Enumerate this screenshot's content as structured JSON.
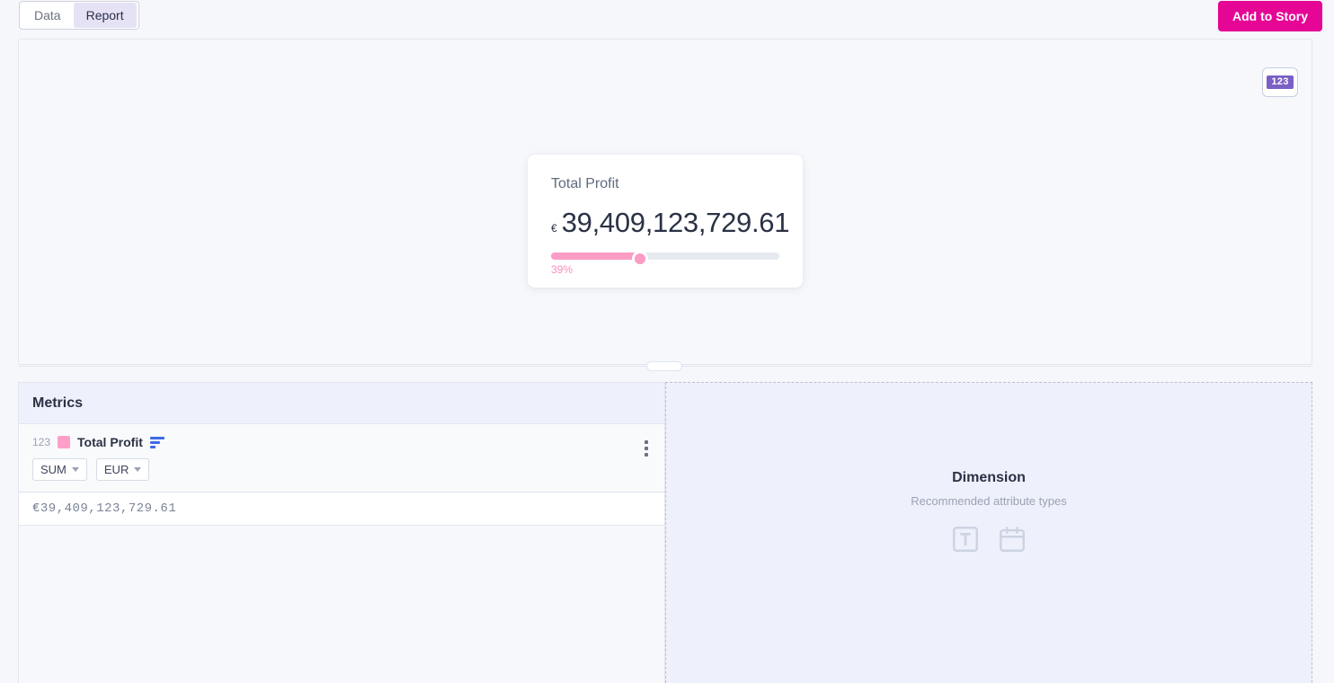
{
  "topbar": {
    "tabs": [
      {
        "label": "Data",
        "active": false
      },
      {
        "label": "Report",
        "active": true
      }
    ],
    "add_to_story_label": "Add to Story"
  },
  "report": {
    "viz_type_badge": "123",
    "viz_type_icon": "number-badge-icon",
    "kpi_card": {
      "title": "Total Profit",
      "currency_symbol": "€",
      "value": "39,409,123,729.61",
      "progress_label": "39%",
      "progress_percent": 39,
      "bar_fill_color": "#fa9cc4",
      "bar_track_color": "#e6e9ef",
      "percent_text_color": "#fa8cbb"
    }
  },
  "metrics_panel": {
    "header": "Metrics",
    "items": [
      {
        "type_label": "123",
        "swatch_color": "#fd9fc8",
        "name": "Total Profit",
        "sort_icon": "sort-descending-icon",
        "aggregation": "SUM",
        "currency": "EUR",
        "menu_icon": "kebab-menu-icon",
        "value": "€39,409,123,729.61"
      }
    ]
  },
  "dimension_zone": {
    "title": "Dimension",
    "subtitle": "Recommended attribute types",
    "icons": [
      "text-attribute-icon",
      "date-attribute-icon"
    ]
  },
  "colors": {
    "accent_pink": "#e50695",
    "badge_purple": "#7a5fc4",
    "tab_active_bg": "#e6e2f5",
    "sort_blue": "#3d6ae8"
  }
}
